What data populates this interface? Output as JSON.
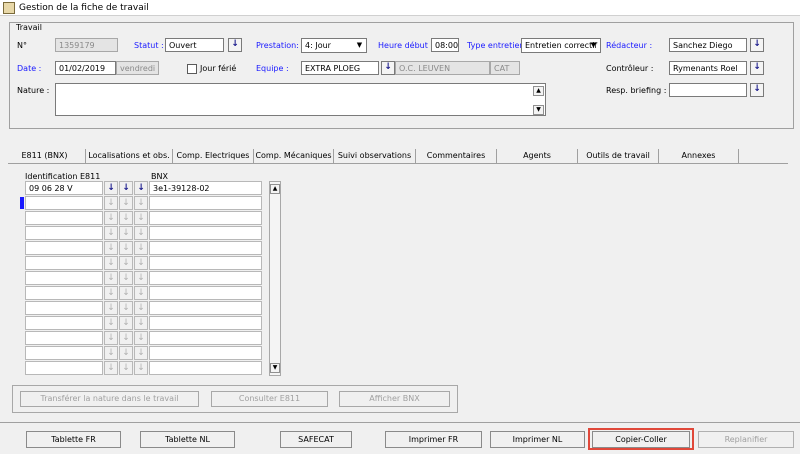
{
  "window": {
    "title": "Gestion de la fiche de travail"
  },
  "group": {
    "title": "Travail"
  },
  "fields": {
    "num_label": "N°",
    "num_value": "1359179",
    "date_label": "Date :",
    "date_value": "01/02/2019",
    "day_value": "vendredi",
    "nature_label": "Nature :",
    "nature_value": "",
    "statut_label": "Statut :",
    "statut_value": "Ouvert",
    "jour_ferie_label": "Jour férié",
    "prestation_label": "Prestation:",
    "prestation_value": "4: Jour",
    "equipe_label": "Equipe :",
    "equipe_value": "EXTRA PLOEG",
    "equipe_desc": "O.C. LEUVEN",
    "equipe_code": "CAT",
    "heure_label": "Heure début :",
    "heure_value": "08:00",
    "type_label": "Type entretien",
    "type_value": "Entretien correctif",
    "redacteur_label": "Rédacteur :",
    "redacteur_value": "Sanchez Diego",
    "controleur_label": "Contrôleur :",
    "controleur_value": "Rymenants Roel",
    "briefing_label": "Resp. briefing :",
    "briefing_value": ""
  },
  "tabs": [
    {
      "label": "E811 (BNX)"
    },
    {
      "label": "Localisations et obs."
    },
    {
      "label": "Comp. Electriques"
    },
    {
      "label": "Comp. Mécaniques"
    },
    {
      "label": "Suivi observations"
    },
    {
      "label": "Commentaires"
    },
    {
      "label": "Agents"
    },
    {
      "label": "Outils de travail"
    },
    {
      "label": "Annexes"
    }
  ],
  "grid": {
    "col1_header": "Identification E811",
    "col2_header": "BNX",
    "rows": [
      {
        "ident": "09 06 28 V",
        "bnx": "3e1-39128-02"
      },
      {
        "ident": "",
        "bnx": ""
      },
      {
        "ident": "",
        "bnx": ""
      },
      {
        "ident": "",
        "bnx": ""
      },
      {
        "ident": "",
        "bnx": ""
      },
      {
        "ident": "",
        "bnx": ""
      },
      {
        "ident": "",
        "bnx": ""
      },
      {
        "ident": "",
        "bnx": ""
      },
      {
        "ident": "",
        "bnx": ""
      },
      {
        "ident": "",
        "bnx": ""
      },
      {
        "ident": "",
        "bnx": ""
      },
      {
        "ident": "",
        "bnx": ""
      },
      {
        "ident": "",
        "bnx": ""
      }
    ]
  },
  "panel_buttons": {
    "transfer": "Transférer la nature dans le travail",
    "consulter": "Consulter E811",
    "afficher": "Afficher BNX"
  },
  "bottom_buttons": {
    "tablette_fr": "Tablette FR",
    "tablette_nl": "Tablette NL",
    "safecat": "SAFECAT",
    "imprimer_fr": "Imprimer FR",
    "imprimer_nl": "Imprimer NL",
    "copier_coller": "Copier-Coller",
    "replanifier": "Replanifier"
  },
  "icons": {
    "download": "↓",
    "dropdown": "▼",
    "scroll_up": "▲",
    "scroll_down": "▼"
  }
}
